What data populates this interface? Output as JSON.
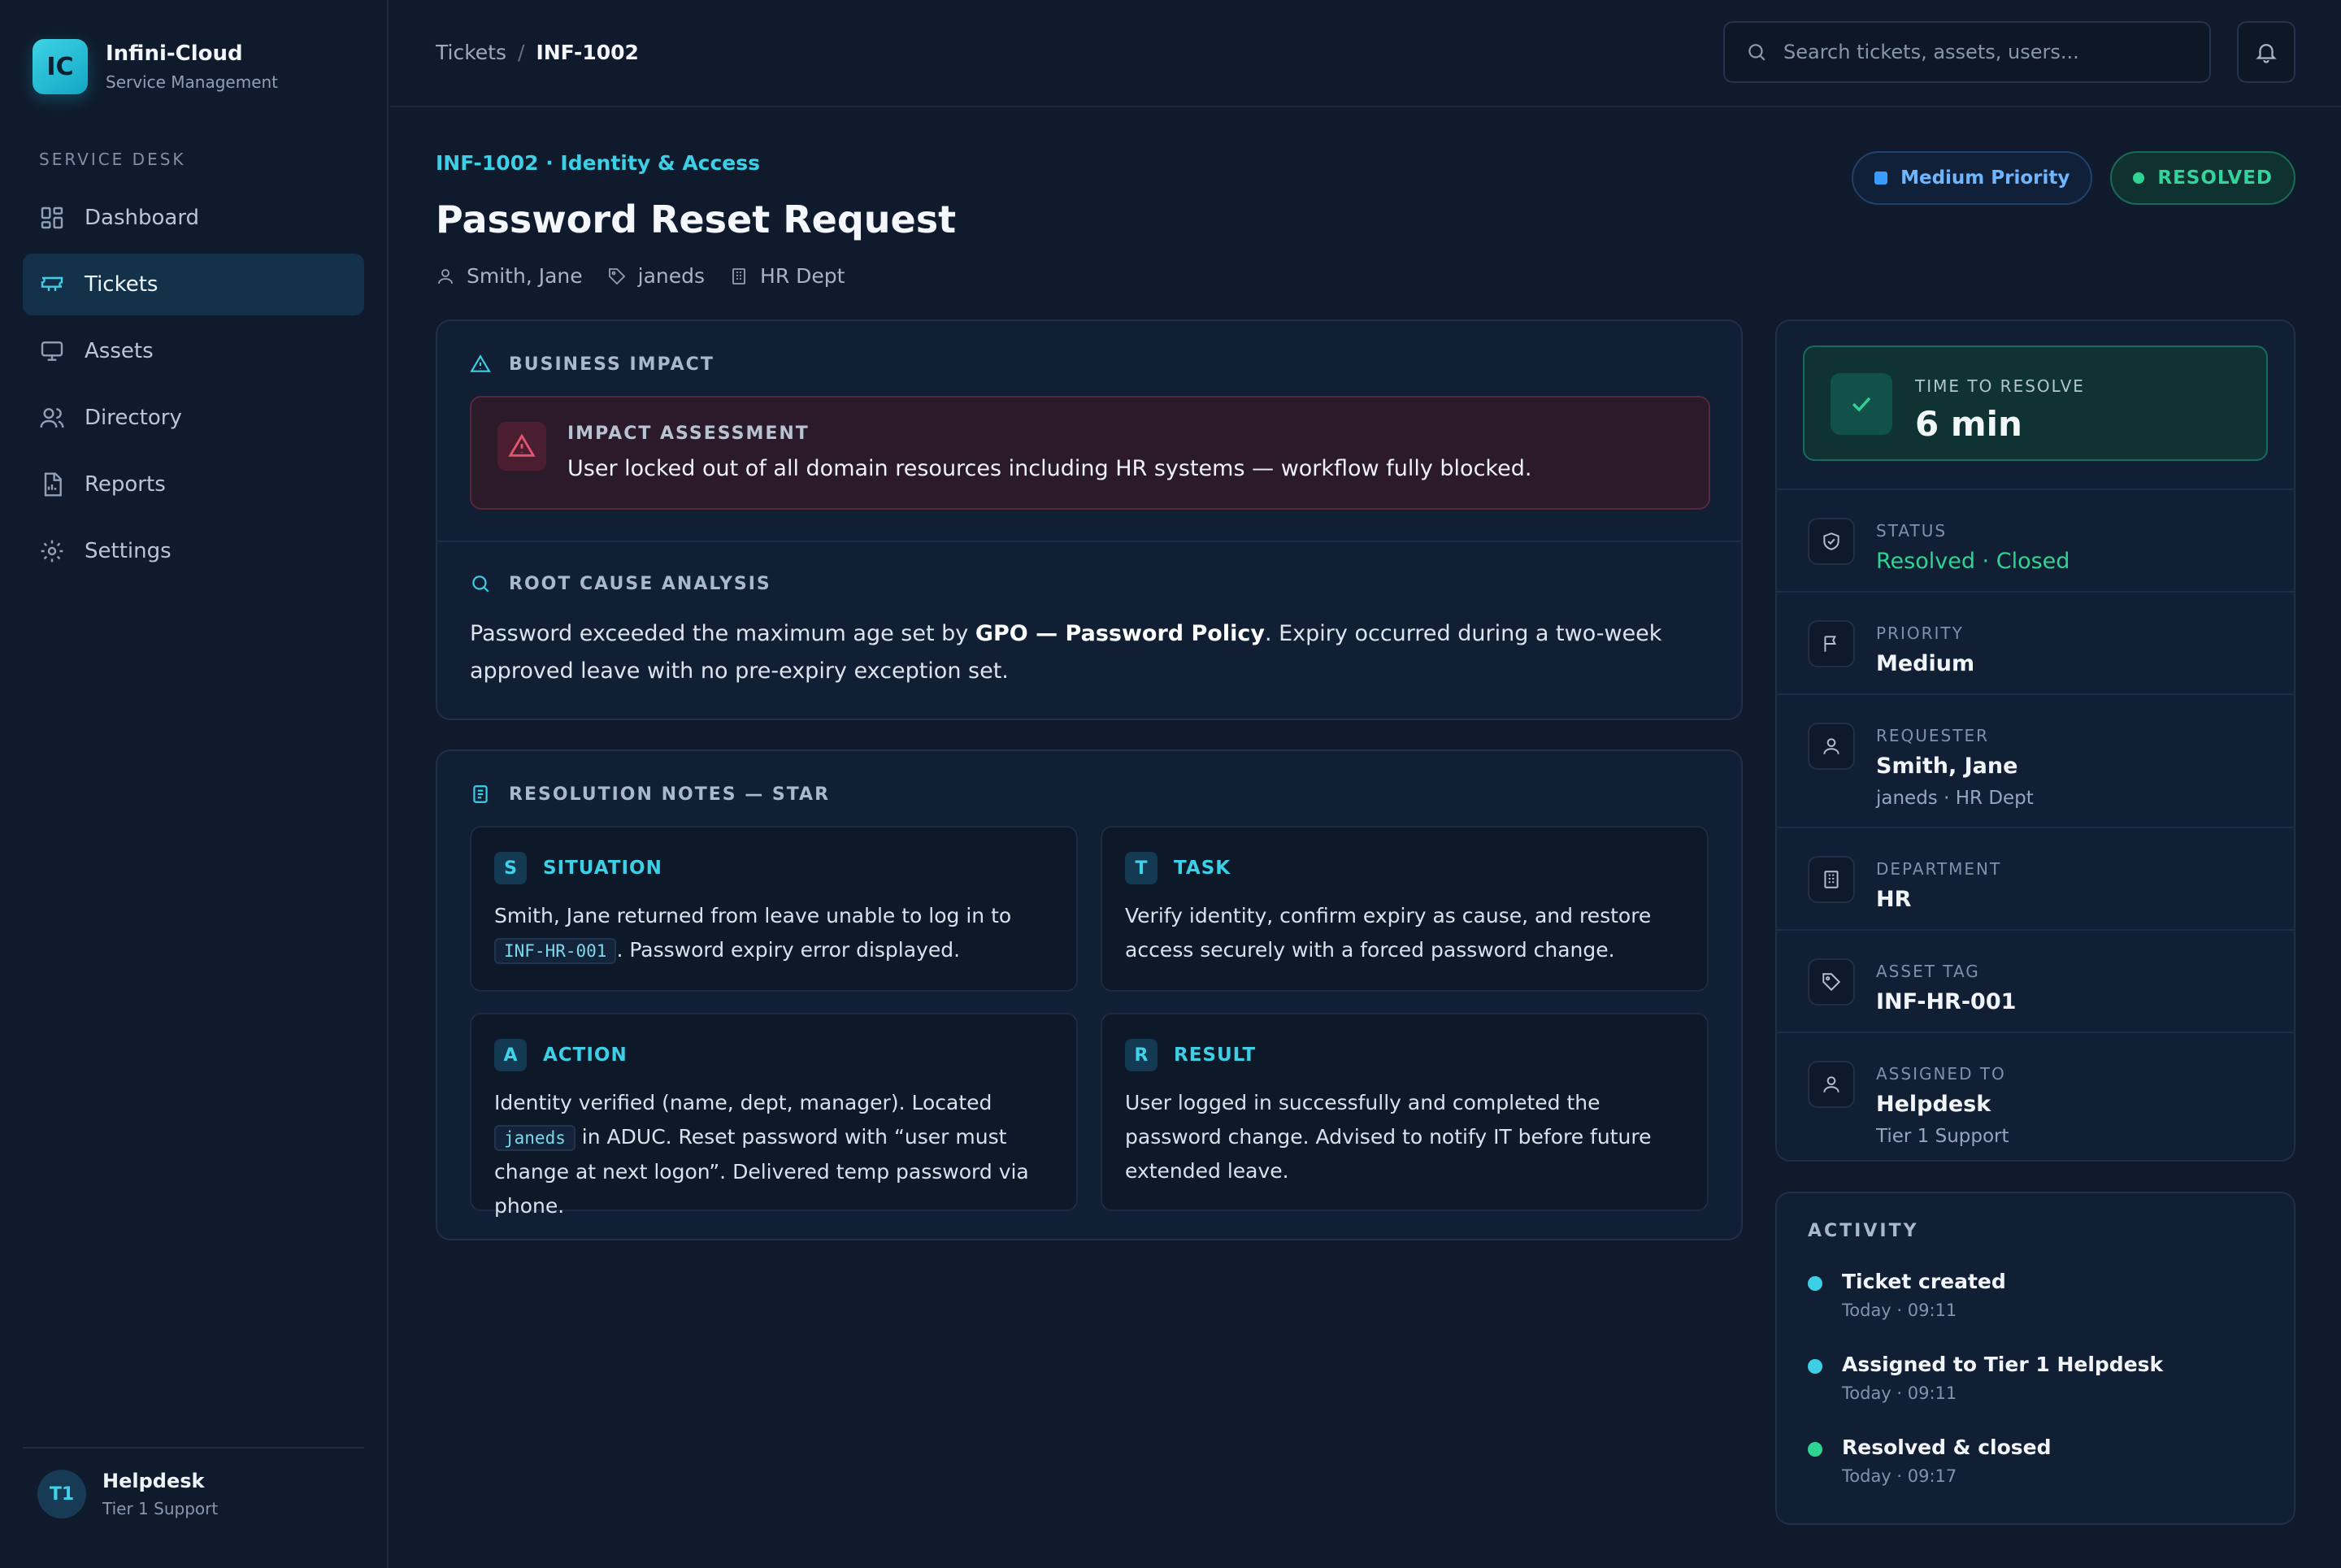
{
  "app": {
    "logo": "IC",
    "name": "Infini-Cloud",
    "subtitle": "Service Management"
  },
  "sidebar": {
    "section": "SERVICE DESK",
    "items": [
      {
        "label": "Dashboard",
        "icon": "dashboard-icon",
        "active": false
      },
      {
        "label": "Tickets",
        "icon": "ticket-icon",
        "active": true
      },
      {
        "label": "Assets",
        "icon": "monitor-icon",
        "active": false
      },
      {
        "label": "Directory",
        "icon": "users-icon",
        "active": false
      },
      {
        "label": "Reports",
        "icon": "report-icon",
        "active": false
      },
      {
        "label": "Settings",
        "icon": "gear-icon",
        "active": false
      }
    ],
    "user": {
      "initials": "T1",
      "name": "Helpdesk",
      "role": "Tier 1 Support"
    }
  },
  "topbar": {
    "breadcrumb": [
      "Tickets",
      "INF-1002"
    ],
    "search_placeholder": "Search tickets, assets, users..."
  },
  "ticket": {
    "id_line": "INF-1002 · Identity & Access",
    "title": "Password Reset Request",
    "requester": "Smith, Jane",
    "username": "janeds",
    "dept": "HR Dept",
    "priority_badge": "Medium Priority",
    "status_badge": "RESOLVED"
  },
  "impact": {
    "label": "BUSINESS IMPACT",
    "assessment_title": "IMPACT ASSESSMENT",
    "assessment_text": "User locked out of all domain resources including HR systems — workflow fully blocked.",
    "rca_label": "ROOT CAUSE ANALYSIS",
    "rca_pre": "Password exceeded the maximum age set by ",
    "rca_bold": "GPO — Password Policy",
    "rca_post": ". Expiry occurred during a two-week approved leave with no pre-expiry exception set."
  },
  "star": {
    "label": "RESOLUTION NOTES — STAR",
    "situation": {
      "letter": "S",
      "title": "SITUATION",
      "pre": "Smith, Jane returned from leave unable to log in to ",
      "code": "INF-HR-001",
      "post": ". Password expiry error displayed."
    },
    "task": {
      "letter": "T",
      "title": "TASK",
      "text": "Verify identity, confirm expiry as cause, and restore access securely with a forced password change."
    },
    "action": {
      "letter": "A",
      "title": "ACTION",
      "pre": "Identity verified (name, dept, manager). Located ",
      "code": "janeds",
      "post": " in ADUC. Reset password with “user must change at next logon”. Delivered temp password via phone."
    },
    "result": {
      "letter": "R",
      "title": "RESULT",
      "text": "User logged in successfully and completed the password change. Advised to notify IT before future extended leave."
    }
  },
  "details": {
    "ttr_label": "TIME TO RESOLVE",
    "ttr_value": "6 min",
    "status_label": "STATUS",
    "status_value": "Resolved · Closed",
    "priority_label": "PRIORITY",
    "priority_value": "Medium",
    "requester_label": "REQUESTER",
    "requester_value": "Smith, Jane",
    "requester_sub": "janeds · HR Dept",
    "department_label": "DEPARTMENT",
    "department_value": "HR",
    "asset_label": "ASSET TAG",
    "asset_value": "INF-HR-001",
    "assigned_label": "ASSIGNED TO",
    "assigned_value": "Helpdesk",
    "assigned_sub": "Tier 1 Support"
  },
  "activity": {
    "title": "ACTIVITY",
    "items": [
      {
        "text": "Ticket created",
        "time": "Today · 09:11"
      },
      {
        "text": "Assigned to Tier 1 Helpdesk",
        "time": "Today · 09:11"
      },
      {
        "text": "Resolved & closed",
        "time": "Today · 09:17"
      }
    ]
  },
  "colors": {
    "accent": "#3dcfe6",
    "success": "#2fd493",
    "priority": "#3b9cff",
    "danger": "#e0566e",
    "background": "#0f1a2c"
  }
}
